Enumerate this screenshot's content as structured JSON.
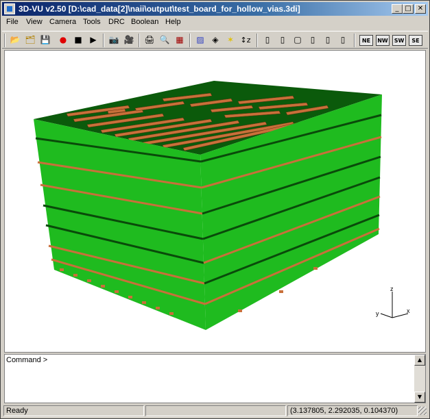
{
  "app": {
    "title": "3D-VU v2.50 [D:\\cad_data[2]\\naii\\output\\test_board_for_hollow_vias.3di]"
  },
  "window_buttons": {
    "minimize": "_",
    "maximize": "□",
    "close": "✕"
  },
  "menu": [
    "File",
    "View",
    "Camera",
    "Tools",
    "DRC",
    "Boolean",
    "Help"
  ],
  "toolbar": {
    "open_icon": "📂",
    "open_project_icon": "🗂",
    "save_icon": "💾",
    "record_icon": "●",
    "stop_icon": "■",
    "play_icon": "▶",
    "camera_icon": "📷",
    "camera2_icon": "🎥",
    "print_icon": "🖨",
    "print_preview_icon": "🔍",
    "print_setup_icon": "▦",
    "color_icon": "▨",
    "layers_icon": "◈",
    "light_icon": "✶",
    "z_scale_label": "↕z",
    "view_buttons": [
      "▯",
      "▯",
      "▢",
      "▯",
      "▯",
      "▯"
    ],
    "ne": "NE",
    "nw": "NW",
    "sw": "SW",
    "se": "SE"
  },
  "axes": {
    "z": "z",
    "y": "y",
    "x": "x"
  },
  "command": {
    "label": "Command >"
  },
  "scroll": {
    "up": "▲",
    "down": "▼"
  },
  "status": {
    "text": "Ready",
    "coordinates": "(3.137805, 2.292035, 0.104370)"
  },
  "colors": {
    "board_green": "#1fbb1f",
    "board_dark_green": "#0a4a0a",
    "copper": "#c8703a",
    "title_blue": "#0a246a"
  }
}
